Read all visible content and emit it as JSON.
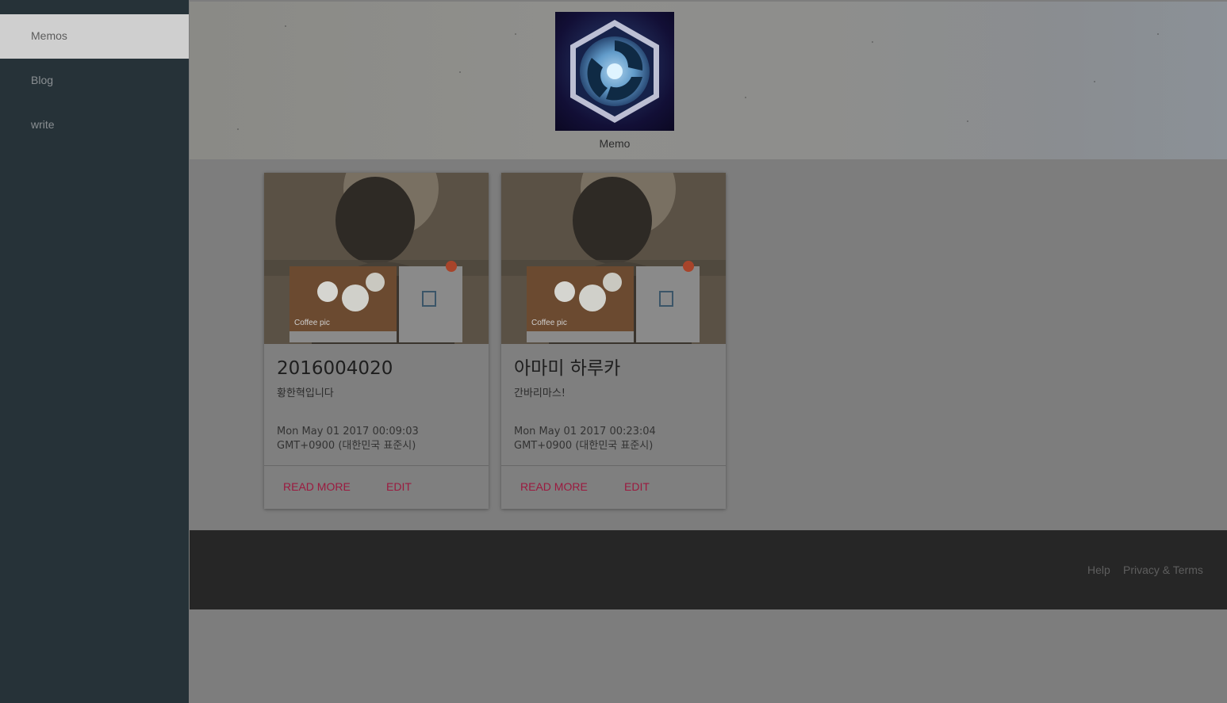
{
  "sidebar": {
    "items": [
      {
        "label": "Memos",
        "active": true
      },
      {
        "label": "Blog",
        "active": false
      },
      {
        "label": "write",
        "active": false
      }
    ]
  },
  "header": {
    "logo_icon": "heroes-hexagon-logo-icon",
    "brand": "Memo"
  },
  "cards": [
    {
      "image_caption": "Coffee pic",
      "title": "2016004020",
      "excerpt": "황한혁입니다",
      "date": "Mon May 01 2017 00:09:03 GMT+0900 (대한민국 표준시)",
      "read_more": "READ MORE",
      "edit": "EDIT"
    },
    {
      "image_caption": "Coffee pic",
      "title": "아마미 하루카",
      "excerpt": "간바리마스!",
      "date": "Mon May 01 2017 00:23:04 GMT+0900 (대한민국 표준시)",
      "read_more": "READ MORE",
      "edit": "EDIT"
    }
  ],
  "footer": {
    "help": "Help",
    "privacy": "Privacy & Terms"
  },
  "colors": {
    "sidebar_bg": "#263238",
    "accent": "#9b1a3f",
    "footer_bg": "#262626"
  }
}
